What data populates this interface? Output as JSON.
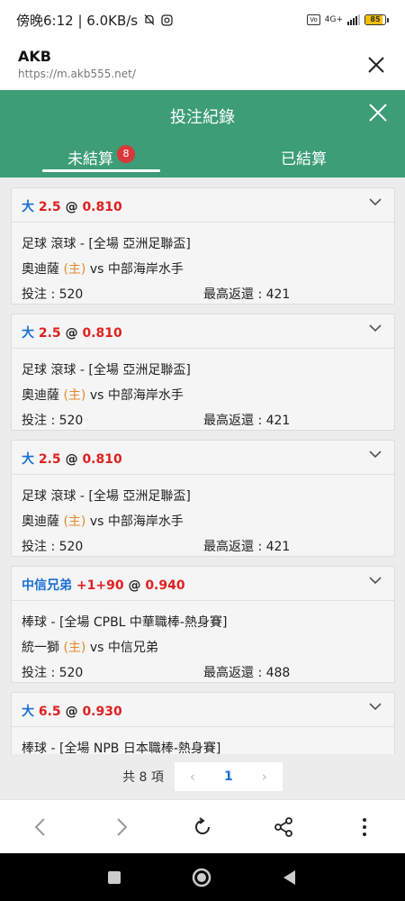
{
  "status_bar": {
    "time_speed": "傍晚6:12 | 6.0KB/s",
    "net_label": "4G+",
    "battery": "85",
    "battery_level": 0.85
  },
  "browser": {
    "title": "AKB",
    "url": "https://m.akb555.net/"
  },
  "app": {
    "title": "投注紀錄",
    "tabs": [
      {
        "label": "未結算",
        "badge": "8",
        "active": true
      },
      {
        "label": "已結算",
        "active": false
      }
    ]
  },
  "bets": [
    {
      "pick": "大",
      "line": "2.5",
      "at": "@",
      "odds": "0.810",
      "league": "足球 滾球 - [全場 亞洲足聯盃]",
      "home": "奧迪薩",
      "home_tag": "(主)",
      "vs": "vs",
      "away": "中部海岸水手",
      "stake": "投注 : 520",
      "max_return": "最高返還 : 421"
    },
    {
      "pick": "大",
      "line": "2.5",
      "at": "@",
      "odds": "0.810",
      "league": "足球 滾球 - [全場 亞洲足聯盃]",
      "home": "奧迪薩",
      "home_tag": "(主)",
      "vs": "vs",
      "away": "中部海岸水手",
      "stake": "投注 : 520",
      "max_return": "最高返還 : 421"
    },
    {
      "pick": "大",
      "line": "2.5",
      "at": "@",
      "odds": "0.810",
      "league": "足球 滾球 - [全場 亞洲足聯盃]",
      "home": "奧迪薩",
      "home_tag": "(主)",
      "vs": "vs",
      "away": "中部海岸水手",
      "stake": "投注 : 520",
      "max_return": "最高返還 : 421"
    },
    {
      "pick": "中信兄弟",
      "line": "+1+90",
      "at": "@",
      "odds": "0.940",
      "league": "棒球 - [全場 CPBL 中華職棒-熱身賽]",
      "home": "統一獅",
      "home_tag": "(主)",
      "vs": "vs",
      "away": "中信兄弟",
      "stake": "投注 : 520",
      "max_return": "最高返還 : 488"
    },
    {
      "pick": "大",
      "line": "6.5",
      "at": "@",
      "odds": "0.930",
      "league": "棒球 - [全場 NPB 日本職棒-熱身賽]"
    }
  ],
  "pagination": {
    "total": "共 8 項",
    "page": "1",
    "prev": "‹",
    "next": "›"
  },
  "toolbar_icons": [
    "back-icon",
    "forward-icon",
    "refresh-icon",
    "share-icon",
    "more-icon"
  ],
  "nav_icons": [
    "recents-icon",
    "home-icon",
    "back-icon"
  ],
  "colors": {
    "header_green": "#3c9d76",
    "pick_blue": "#1a6fd6",
    "odds_red": "#e02020",
    "home_orange": "#e48a2a",
    "badge_red": "#d9383a"
  }
}
